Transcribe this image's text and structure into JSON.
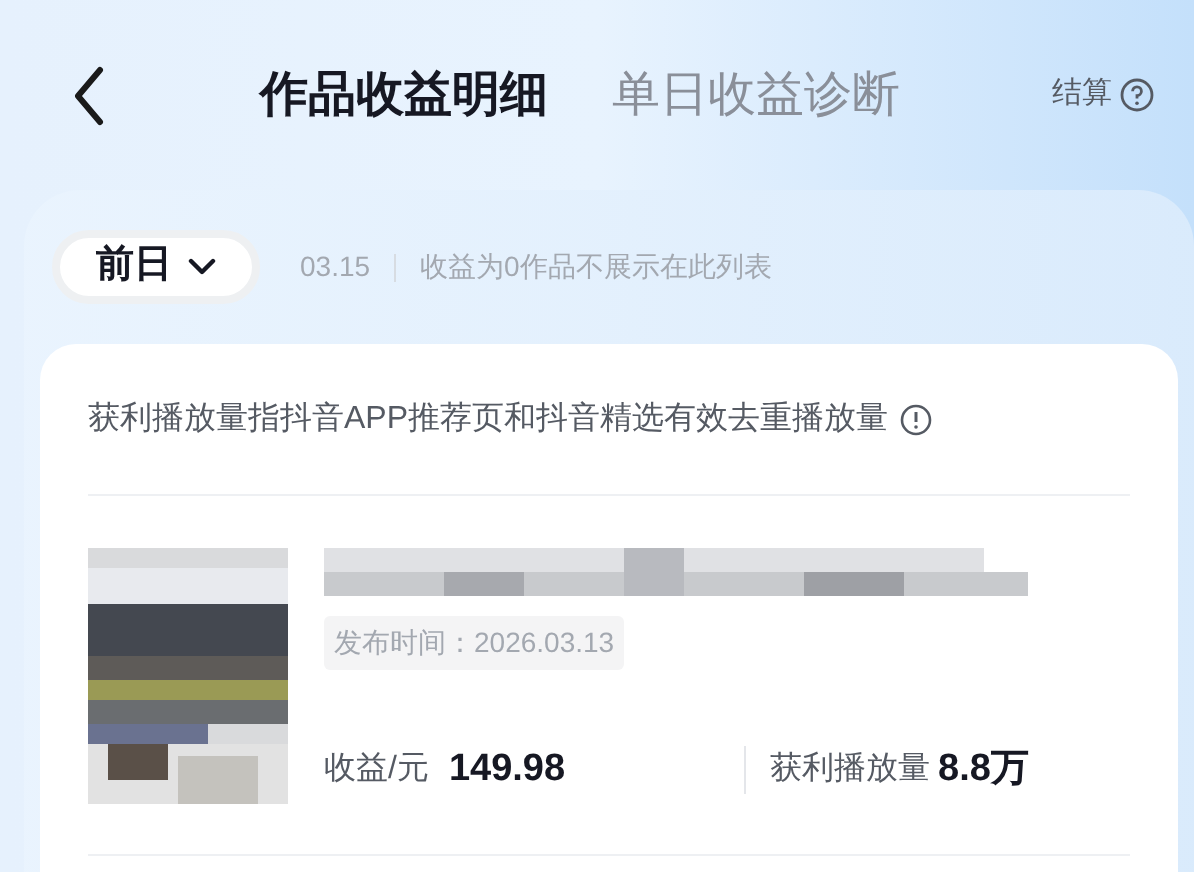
{
  "header": {
    "tabs": [
      {
        "label": "作品收益明细",
        "selected": true
      },
      {
        "label": "单日收益诊断",
        "selected": false
      }
    ],
    "settle": {
      "label": "结算"
    }
  },
  "filter": {
    "dropdown": "前日",
    "date": "03.15",
    "note": "收益为0作品不展示在此列表"
  },
  "card": {
    "info": "获利播放量指抖音APP推荐页和抖音精选有效去重播放量",
    "works": [
      {
        "publish": "发布时间：2026.03.13",
        "income_label": "收益/元",
        "income": "149.98",
        "plays_label": "获利播放量",
        "plays": "8.8万"
      }
    ]
  }
}
